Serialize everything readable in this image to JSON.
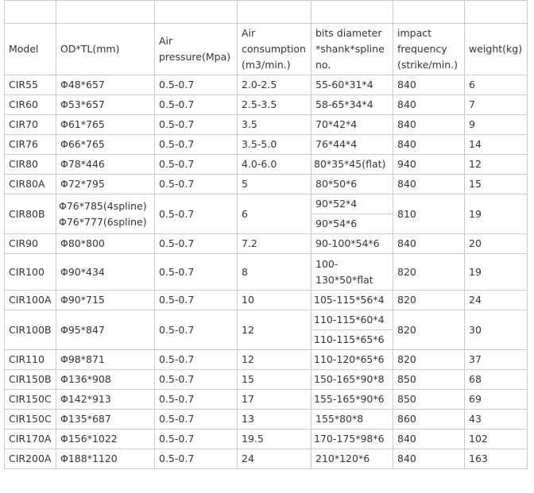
{
  "headers": {
    "model": "Model",
    "od_tl": "OD*TL(mm)",
    "air_pressure": "Air pressure(Mpa)",
    "air_consumption": "Air consumption (m3/min.)",
    "bits": "bits diameter *shank*spline no.",
    "impact": "impact frequency (strike/min.)",
    "weight": "weight(kg)"
  },
  "rows": [
    {
      "model": "CIR55",
      "od_tl": "Φ48*657",
      "pressure": "0.5-0.7",
      "consumption": "2.0-2.5",
      "bits": "55-60*31*4",
      "impact": "840",
      "weight": "6"
    },
    {
      "model": "CIR60",
      "od_tl": "Φ53*657",
      "pressure": "0.5-0.7",
      "consumption": "2.5-3.5",
      "bits": "58-65*34*4",
      "impact": "840",
      "weight": "7"
    },
    {
      "model": "CIR70",
      "od_tl": "Φ61*765",
      "pressure": "0.5-0.7",
      "consumption": "3.5",
      "bits": "70*42*4",
      "impact": "840",
      "weight": "9"
    },
    {
      "model": "CIR76",
      "od_tl": "Φ66*765",
      "pressure": "0.5-0.7",
      "consumption": "3.5-5.0",
      "bits": "76*44*4",
      "impact": "840",
      "weight": "14"
    },
    {
      "model": "CIR80",
      "od_tl": "Φ78*446",
      "pressure": "0.5-0.7",
      "consumption": "4.0-6.0",
      "bits": "80*35*45(flat)",
      "impact": "940",
      "weight": "12"
    },
    {
      "model": "CIR80A",
      "od_tl": "Φ72*795",
      "pressure": "0.5-0.7",
      "consumption": "5",
      "bits": "80*50*6",
      "impact": "840",
      "weight": "15"
    },
    {
      "model": "CIR80B",
      "od_tl_1": "Φ76*785(4spline)",
      "od_tl_2": "Φ76*777(6spline)",
      "pressure": "0.5-0.7",
      "consumption": "6",
      "bits_1": "90*52*4",
      "bits_2": "90*54*6",
      "impact": "810",
      "weight": "19"
    },
    {
      "model": "CIR90",
      "od_tl": "Φ80*800",
      "pressure": "0.5-0.7",
      "consumption": "7.2",
      "bits": "90-100*54*6",
      "impact": "840",
      "weight": "20"
    },
    {
      "model": "CIR100",
      "od_tl": "Φ90*434",
      "pressure": "0.5-0.7",
      "consumption": "8",
      "bits_1": "100-",
      "bits_2": "130*50*flat",
      "impact": "820",
      "weight": "19"
    },
    {
      "model": "CIR100A",
      "od_tl": "Φ90*715",
      "pressure": "0.5-0.7",
      "consumption": "10",
      "bits": "105-115*56*4",
      "impact": "820",
      "weight": "24"
    },
    {
      "model": "CIR100B",
      "od_tl": "Φ95*847",
      "pressure": "0.5-0.7",
      "consumption": "12",
      "bits_1": "110-115*60*4",
      "bits_2": "110-115*65*6",
      "impact": "820",
      "weight": "30"
    },
    {
      "model": "CIR110",
      "od_tl": "Φ98*871",
      "pressure": "0.5-0.7",
      "consumption": "12",
      "bits": "110-120*65*6",
      "impact": "820",
      "weight": "37"
    },
    {
      "model": "CIR150B",
      "od_tl": "Φ136*908",
      "pressure": "0.5-0.7",
      "consumption": "15",
      "bits": "150-165*90*8",
      "impact": "850",
      "weight": "68"
    },
    {
      "model": "CIR150C",
      "od_tl": "Φ142*913",
      "pressure": "0.5-0.7",
      "consumption": "17",
      "bits": "155-165*90*6",
      "impact": "850",
      "weight": "69"
    },
    {
      "model": "CIR150C",
      "od_tl": "Φ135*687",
      "pressure": "0.5-0.7",
      "consumption": "13",
      "bits": "155*80*8",
      "impact": "860",
      "weight": "43"
    },
    {
      "model": "CIR170A",
      "od_tl": "Φ156*1022",
      "pressure": "0.5-0.7",
      "consumption": "19.5",
      "bits": "170-175*98*6",
      "impact": "840",
      "weight": "102"
    },
    {
      "model": "CIR200A",
      "od_tl": "Φ188*1120",
      "pressure": "0.5-0.7",
      "consumption": "24",
      "bits": "210*120*6",
      "impact": "840",
      "weight": "163"
    }
  ]
}
